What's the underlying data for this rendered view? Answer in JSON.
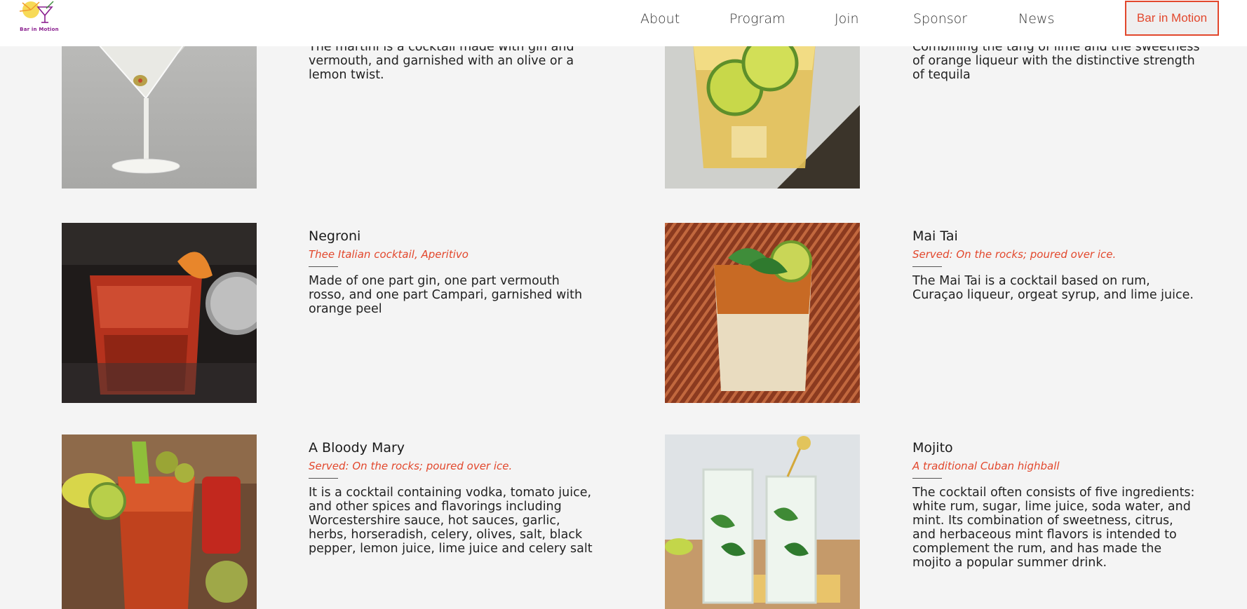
{
  "header": {
    "logo_text": "Bar in Motion",
    "nav": [
      "About",
      "Program",
      "Join",
      "Sponsor",
      "News"
    ],
    "cta_label": "Bar in Motion"
  },
  "colors": {
    "accent": "#e2472c",
    "background": "#f4f4f4",
    "header_bg": "#ffffff"
  },
  "cocktails": [
    {
      "image": "martini-photo",
      "name": "",
      "served": "",
      "description": "The martini is a cocktail made with gin and vermouth, and garnished with an olive or a lemon twist."
    },
    {
      "image": "margarita-photo",
      "name": "",
      "served": "",
      "description": "Combining the tang of lime and the sweetness of orange liqueur with the distinctive strength of tequila"
    },
    {
      "image": "negroni-photo",
      "name": "Negroni",
      "served": "Thee Italian cocktail, Aperitivo",
      "description": "Made of one part gin, one part vermouth rosso, and one part Campari, garnished with orange peel"
    },
    {
      "image": "mai-tai-photo",
      "name": "Mai Tai",
      "served": "Served: On the rocks; poured over ice.",
      "description": "The Mai Tai is a cocktail based on rum, Curaçao liqueur, orgeat syrup, and lime juice."
    },
    {
      "image": "bloody-mary-photo",
      "name": "A Bloody Mary",
      "served": "Served: On the rocks; poured over ice.",
      "description": "It is a cocktail containing vodka, tomato juice, and other spices and flavorings including Worcestershire sauce, hot sauces, garlic, herbs, horseradish, celery, olives, salt, black pepper, lemon juice, lime juice and celery salt"
    },
    {
      "image": "mojito-photo",
      "name": "Mojito",
      "served": "A traditional Cuban highball",
      "description": "The cocktail often consists of five ingredients: white rum, sugar, lime juice, soda water, and mint. Its combination of sweetness, citrus, and herbaceous mint flavors is intended to complement the rum, and has made the mojito a popular summer drink."
    }
  ]
}
